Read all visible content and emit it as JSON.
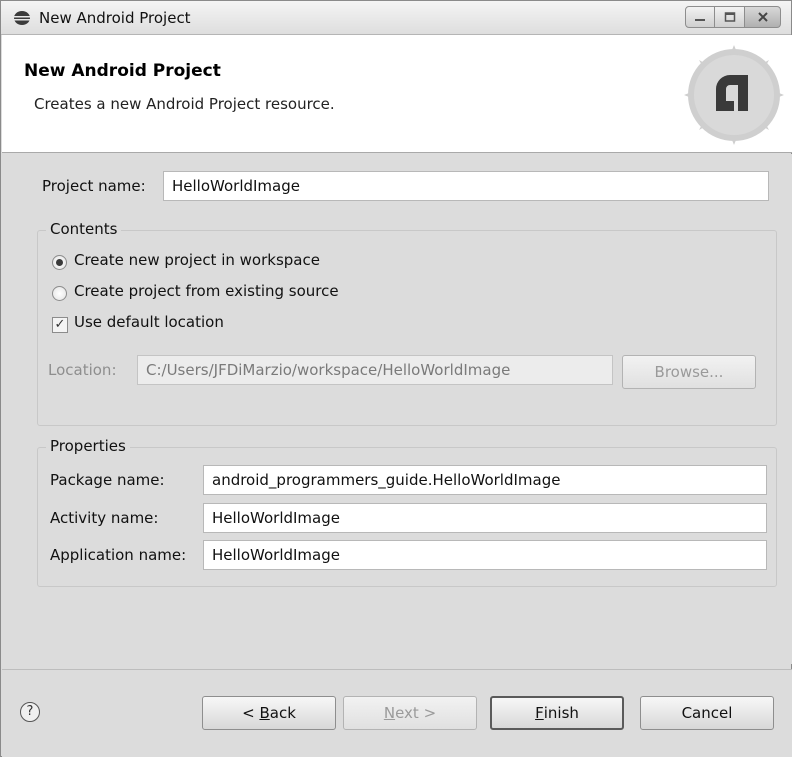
{
  "window": {
    "title": "New Android Project",
    "icon": "eclipse-icon",
    "controls": [
      "minimize-icon",
      "maximize-icon",
      "close-icon"
    ]
  },
  "banner": {
    "title": "New Android Project",
    "description": "Creates a new Android Project resource.",
    "logo": "android-logo-icon"
  },
  "project": {
    "name_label": "Project name:",
    "name_value": "HelloWorldImage"
  },
  "contents": {
    "title": "Contents",
    "option_new": "Create new project in workspace",
    "option_existing": "Create project from existing source",
    "use_default_label": "Use default location",
    "use_default_checked": true,
    "selected_option": "Create new project in workspace",
    "location_label": "Location:",
    "location_value": "C:/Users/JFDiMarzio/workspace/HelloWorldImage",
    "browse_label": "Browse..."
  },
  "properties": {
    "title": "Properties",
    "package_label": "Package name:",
    "package_value": "android_programmers_guide.HelloWorldImage",
    "activity_label": "Activity name:",
    "activity_value": "HelloWorldImage",
    "app_label": "Application name:",
    "app_value": "HelloWorldImage"
  },
  "footer": {
    "help_glyph": "?",
    "back_pre": "< ",
    "back_key": "B",
    "back_post": "ack",
    "next_key": "N",
    "next_post": "ext >",
    "finish_key": "F",
    "finish_post": "inish",
    "cancel_label": "Cancel"
  }
}
